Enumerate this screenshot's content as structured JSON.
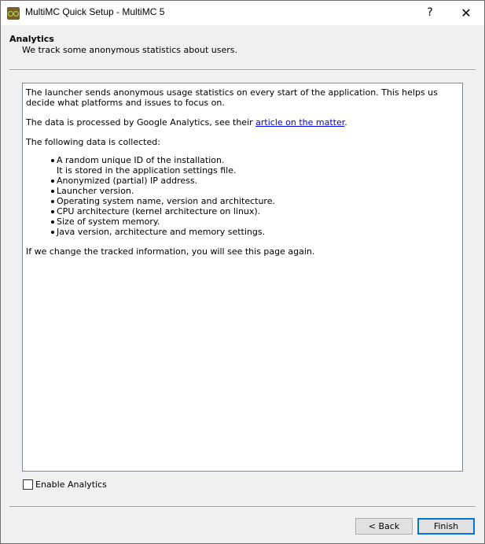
{
  "window": {
    "title": "MultiMC Quick Setup - MultiMC 5",
    "help_glyph": "?",
    "close_glyph": "✕"
  },
  "header": {
    "title": "Analytics",
    "subtitle": "We track some anonymous statistics about users."
  },
  "body": {
    "para1": "The launcher sends anonymous usage statistics on every start of the application. This helps us decide what platforms and issues to focus on.",
    "para2_prefix": "The data is processed by Google Analytics, see their ",
    "para2_link": "article on the matter",
    "para2_suffix": ".",
    "para3": "The following data is collected:",
    "items": [
      "A random unique ID of the installation.",
      "Anonymized (partial) IP address.",
      "Launcher version.",
      "Operating system name, version and architecture.",
      "CPU architecture (kernel architecture on linux).",
      "Size of system memory.",
      "Java version, architecture and memory settings."
    ],
    "item0_sub": "It is stored in the application settings file.",
    "para4": "If we change the tracked information, you will see this page again."
  },
  "checkbox": {
    "label": "Enable Analytics",
    "checked": false
  },
  "buttons": {
    "back": "< Back",
    "finish": "Finish"
  }
}
